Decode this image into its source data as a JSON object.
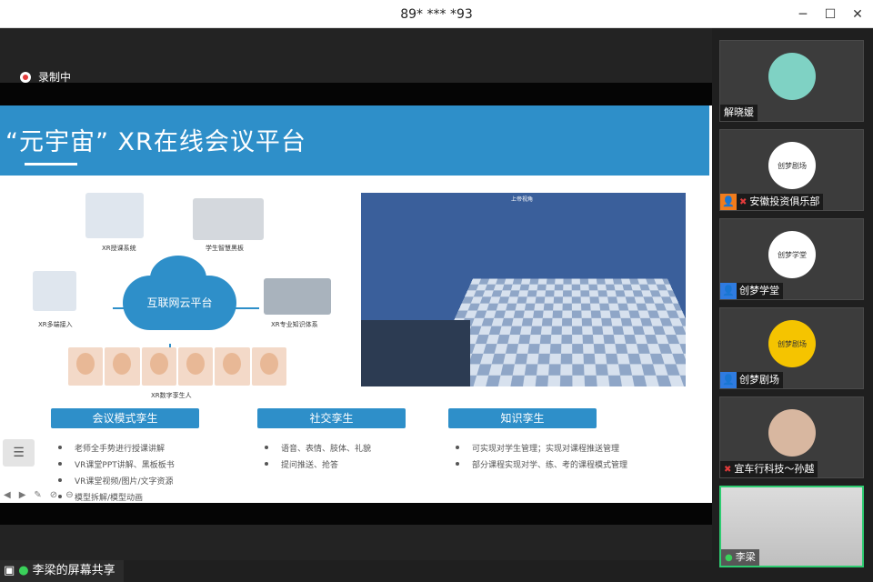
{
  "window": {
    "title": "89* *** *93",
    "minimize": "─",
    "maximize": "☐",
    "close": "✕"
  },
  "recording": {
    "label": "录制中"
  },
  "slide": {
    "title": "“元宇宙” XR在线会议平台",
    "diagram": {
      "center": "互联网云平台",
      "captions": [
        "XR授课系统",
        "学生智慧黑板",
        "XR多端接入",
        "XR专业知识体系",
        "XR数字孪生人"
      ]
    },
    "scene_label": "上帝视角",
    "sections": [
      {
        "label": "会议模式孪生",
        "bullets": [
          "老师全手势进行授课讲解",
          "VR课堂PPT讲解、黑板板书",
          "VR课堂视频/图片/文字资源",
          "模型拆解/模型动画"
        ]
      },
      {
        "label": "社交孪生",
        "bullets": [
          "语音、表情、肢体、礼貌",
          "提问推送、抢答"
        ]
      },
      {
        "label": "知识孪生",
        "bullets": [
          "可实现对学生管理；实现对课程推送管理",
          "部分课程实现对学、练、考的课程模式管理"
        ]
      }
    ],
    "controls": [
      "◀",
      "▶",
      "✎",
      "⊘",
      "⊖"
    ],
    "menu_icon": "☰"
  },
  "share_bar": {
    "label": "李梁的屏幕共享"
  },
  "participants": [
    {
      "name": "解晓媛",
      "avatar_text": "",
      "avatar_color": "#7fd2c4",
      "status": "none"
    },
    {
      "name": "安徽投资俱乐部",
      "avatar_text": "创梦剧场",
      "avatar_color": "#ffffff",
      "status": "muted",
      "icon": "orange"
    },
    {
      "name": "创梦学堂",
      "avatar_text": "创梦学堂",
      "avatar_color": "#ffffff",
      "status": "user",
      "icon": "blue"
    },
    {
      "name": "创梦剧场",
      "avatar_text": "创梦剧场",
      "avatar_color": "#f5c400",
      "status": "user",
      "icon": "blue"
    },
    {
      "name": "宜车行科技～孙越",
      "avatar_text": "",
      "avatar_color": "#d8b7a0",
      "status": "muted"
    },
    {
      "name": "李梁",
      "avatar_text": "",
      "avatar_color": "#ccc",
      "status": "speaking"
    }
  ],
  "colors": {
    "accent": "#2e8fc9",
    "active_border": "#2ecc71",
    "muted": "#e23b3b"
  }
}
